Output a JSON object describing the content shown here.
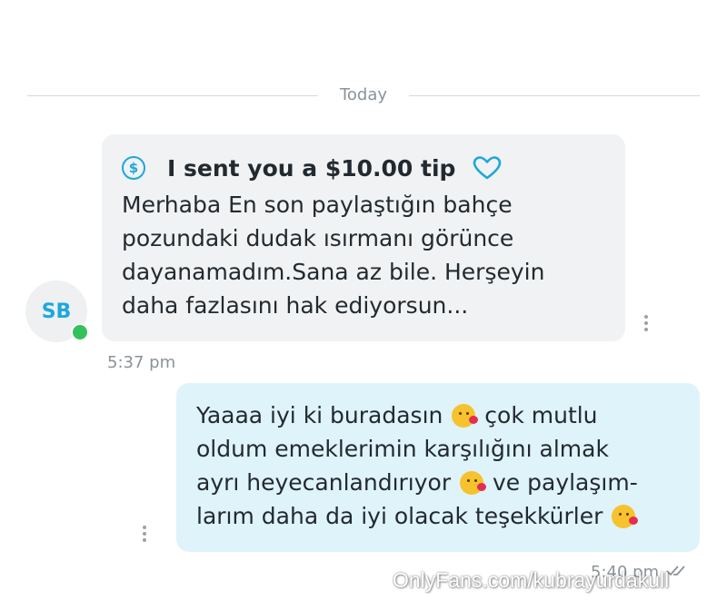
{
  "divider": {
    "label": "Today"
  },
  "incoming": {
    "avatar_initials": "SB",
    "tip_text": "I sent you a $10.00 tip",
    "tip_icon": "dollar-circle-icon",
    "heart_icon": "heart-icon",
    "message": "Merhaba En son paylaştığın bahçe\npozundaki dudak ısırmanı görünce\ndayanamadım.Sana az bile. Herşeyin\ndaha fazlasını hak ediyorsun...",
    "time": "5:37 pm"
  },
  "outgoing": {
    "lines": [
      [
        "Yaaaa iyi ki buradasın ",
        "emoji",
        " çok mutlu"
      ],
      [
        "oldum emeklerimin karşılığını almak"
      ],
      [
        "ayrı heyecanlandırıyor ",
        "emoji",
        " ve paylaşım-"
      ],
      [
        "larım daha da iyi olacak teşekkürler ",
        "emoji"
      ]
    ],
    "emoji_name": "face-blowing-kiss",
    "time": "5:40 pm",
    "status_icon": "double-check-icon"
  },
  "watermark": "OnlyFans.com/kubrayurdakull",
  "colors": {
    "accent": "#1ea7dc",
    "incoming_bubble": "#f0f2f3",
    "outgoing_bubble": "#dff3fb",
    "online": "#33c15c"
  }
}
